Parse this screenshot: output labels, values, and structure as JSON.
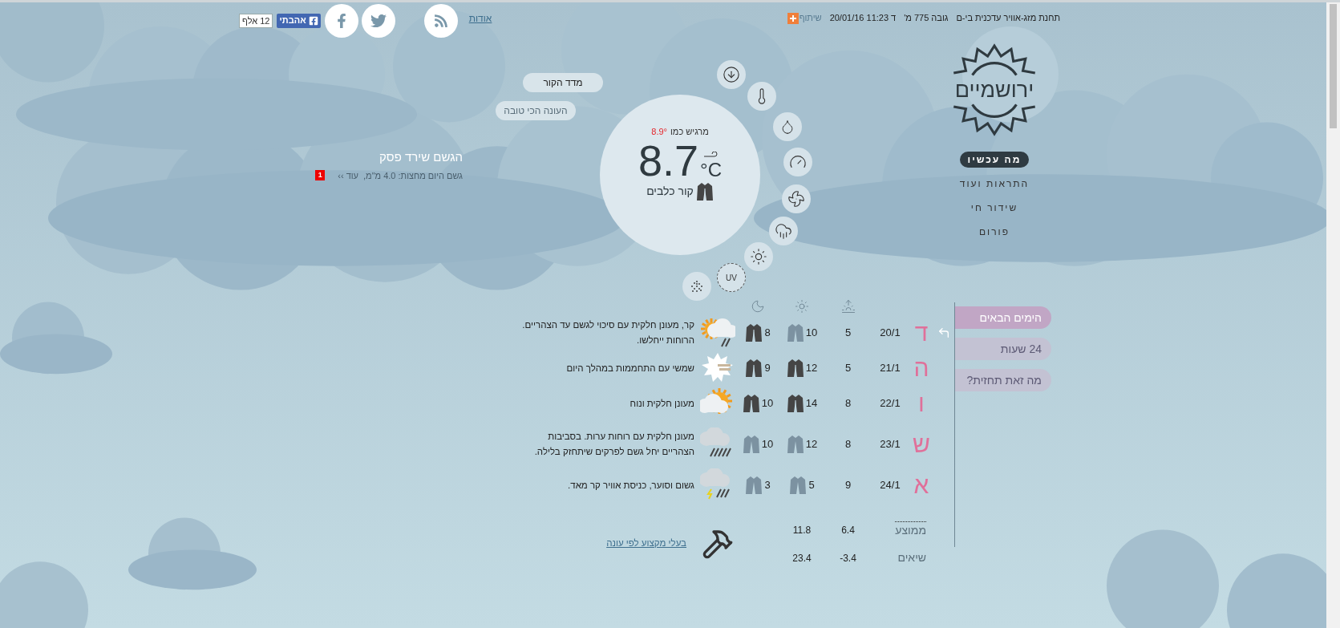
{
  "top_bar": {
    "like_count": "12 אלף",
    "like_button": "אהבתי",
    "about_link": "אודות",
    "share": "שיתוף",
    "datetime": "ד 11:23 20/01/16",
    "elevation": "גובה 775 מ'",
    "station": "תחנת מזג-אוויר עדכנית בי-ם"
  },
  "rain_note": {
    "title": "הגשם שירד פסק",
    "text": "גשם היום מחצות: 4.0 מ\"מ,",
    "more_link": "עוד ››",
    "badge": "1"
  },
  "pills": [
    "מדד הקור",
    "העונה הכי טובה"
  ],
  "current": {
    "feels_like_label": "מרגיש כמו",
    "feels_like": "8.9°",
    "temperature": "8.7",
    "unit": "°C",
    "condition": "קור כלבים",
    "uv_label": "UV"
  },
  "logo": {
    "text": "ירושמיים"
  },
  "nav": [
    {
      "label": "מה עכשיו",
      "selected": true
    },
    {
      "label": "התראות ועוד",
      "selected": false
    },
    {
      "label": "שידור חי",
      "selected": false
    },
    {
      "label": "פורום",
      "selected": false
    }
  ],
  "forecast": {
    "rows": [
      {
        "kind": "partly-cloudy-rain",
        "day": "ד",
        "date": "20/1",
        "min": "5",
        "temps": [
          {
            "kind": "light",
            "value": "10"
          },
          {
            "kind": "heavy",
            "value": "8"
          }
        ],
        "description": "קר, מעונן חלקית עם סיכוי לגשם עד הצהריים. הרוחות ייחלשו.",
        "current": true
      },
      {
        "kind": "sunny-hazy",
        "day": "ה",
        "date": "21/1",
        "min": "5",
        "temps": [
          {
            "kind": "heavy",
            "value": "12"
          },
          {
            "kind": "heavy",
            "value": "9"
          }
        ],
        "description": "שמשי עם התחממות במהלך היום",
        "current": false
      },
      {
        "kind": "partly-cloudy",
        "day": "ו",
        "date": "22/1",
        "min": "8",
        "temps": [
          {
            "kind": "heavy",
            "value": "14"
          },
          {
            "kind": "heavy",
            "value": "10"
          }
        ],
        "description": "מעונן חלקית ונוח",
        "current": false
      },
      {
        "kind": "rain",
        "day": "ש",
        "date": "23/1",
        "min": "8",
        "temps": [
          {
            "kind": "light",
            "value": "12"
          },
          {
            "kind": "light",
            "value": "10"
          }
        ],
        "description": "מעונן חלקית עם רוחות ערות. בסביבות הצהריים יחל גשם לפרקים שיתחזק בלילה.",
        "current": false
      },
      {
        "kind": "thunderstorm",
        "day": "א",
        "date": "24/1",
        "min": "9",
        "temps": [
          {
            "kind": "light",
            "value": "5"
          },
          {
            "kind": "light",
            "value": "3"
          }
        ],
        "description": "גשום וסוער, כניסת אוויר קר מאד.",
        "current": false
      }
    ],
    "stats": [
      {
        "label": "ממוצע",
        "min": "6.4",
        "max": "11.8"
      },
      {
        "label": "שיאים",
        "min": "-3.4",
        "max": "23.4"
      }
    ],
    "pros_link": "בעלי מקצוע לפי עונה"
  },
  "tabs": [
    {
      "label": "הימים הבאים",
      "selected": true
    },
    {
      "label": "24 שעות",
      "selected": false
    },
    {
      "label": "מה זאת תחזית?",
      "selected": false
    }
  ]
}
